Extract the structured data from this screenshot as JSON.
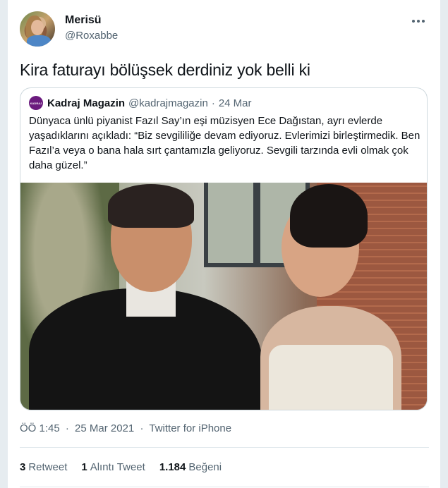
{
  "tweet": {
    "author_name": "Merisü",
    "author_handle": "@Roxabbe",
    "text": "Kira faturayı bölüşsek derdiniz yok belli ki",
    "time": "ÖÖ 1:45",
    "date": "25 Mar 2021",
    "source": "Twitter for iPhone",
    "separator": "·"
  },
  "quote": {
    "logo_text": "KADRAJ",
    "author_name": "Kadraj Magazin",
    "author_handle": "@kadrajmagazin",
    "separator": "·",
    "date": "24 Mar",
    "text": "Dünyaca ünlü piyanist Fazıl Say’ın eşi müzisyen Ece Dağıstan, ayrı evlerde yaşadıklarını açıkladı: “Biz sevgililiğe devam ediyoruz. Evlerimizi birleştirmedik. Ben Fazıl’a veya o bana hala sırt çantamızla geliyoruz. Sevgili tarzında evli olmak çok daha güzel.”"
  },
  "stats": {
    "retweets_count": "3",
    "retweets_label": "Retweet",
    "quotes_count": "1",
    "quotes_label": "Alıntı Tweet",
    "likes_count": "1.184",
    "likes_label": "Beğeni"
  },
  "icons": {
    "more": "more-horizontal-icon"
  },
  "colors": {
    "primary_text": "#0f1419",
    "secondary_text": "#536471",
    "border": "#cfd9de",
    "quote_logo": "#6b1b7e"
  }
}
